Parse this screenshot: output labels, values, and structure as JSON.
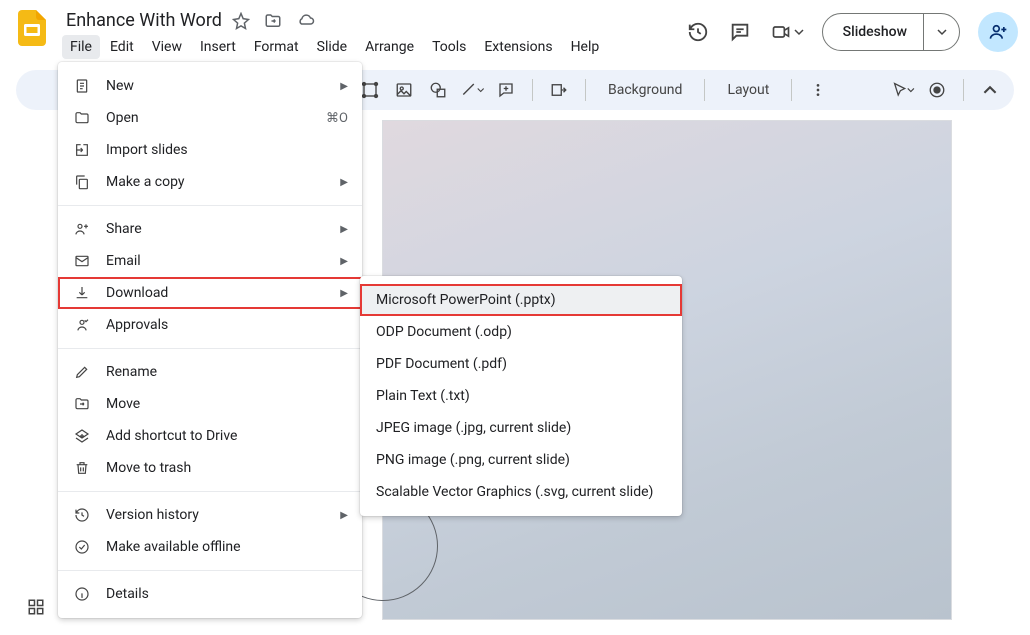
{
  "doc": {
    "title": "Enhance With Word"
  },
  "menubar": [
    "File",
    "Edit",
    "View",
    "Insert",
    "Format",
    "Slide",
    "Arrange",
    "Tools",
    "Extensions",
    "Help"
  ],
  "active_menu_index": 0,
  "top_actions": {
    "slideshow_label": "Slideshow"
  },
  "toolbar": {
    "background": "Background",
    "layout": "Layout"
  },
  "file_menu": {
    "groups": [
      [
        {
          "id": "new",
          "label": "New",
          "icon": "doc",
          "submenu": true
        },
        {
          "id": "open",
          "label": "Open",
          "icon": "folder",
          "shortcut": "⌘O"
        },
        {
          "id": "import",
          "label": "Import slides",
          "icon": "import"
        },
        {
          "id": "copy",
          "label": "Make a copy",
          "icon": "copy",
          "submenu": true
        }
      ],
      [
        {
          "id": "share",
          "label": "Share",
          "icon": "share",
          "submenu": true
        },
        {
          "id": "email",
          "label": "Email",
          "icon": "email",
          "submenu": true
        },
        {
          "id": "download",
          "label": "Download",
          "icon": "download",
          "submenu": true,
          "highlighted": true
        },
        {
          "id": "approvals",
          "label": "Approvals",
          "icon": "approvals"
        }
      ],
      [
        {
          "id": "rename",
          "label": "Rename",
          "icon": "rename"
        },
        {
          "id": "move",
          "label": "Move",
          "icon": "move"
        },
        {
          "id": "shortcut",
          "label": "Add shortcut to Drive",
          "icon": "shortcut"
        },
        {
          "id": "trash",
          "label": "Move to trash",
          "icon": "trash"
        }
      ],
      [
        {
          "id": "history",
          "label": "Version history",
          "icon": "history",
          "submenu": true
        },
        {
          "id": "offline",
          "label": "Make available offline",
          "icon": "offline"
        }
      ],
      [
        {
          "id": "details",
          "label": "Details",
          "icon": "details"
        }
      ]
    ]
  },
  "download_submenu": [
    {
      "label": "Microsoft PowerPoint (.pptx)",
      "highlighted": true
    },
    {
      "label": "ODP Document (.odp)"
    },
    {
      "label": "PDF Document (.pdf)"
    },
    {
      "label": "Plain Text (.txt)"
    },
    {
      "label": "JPEG image (.jpg, current slide)"
    },
    {
      "label": "PNG image (.png, current slide)"
    },
    {
      "label": "Scalable Vector Graphics (.svg, current slide)"
    }
  ]
}
